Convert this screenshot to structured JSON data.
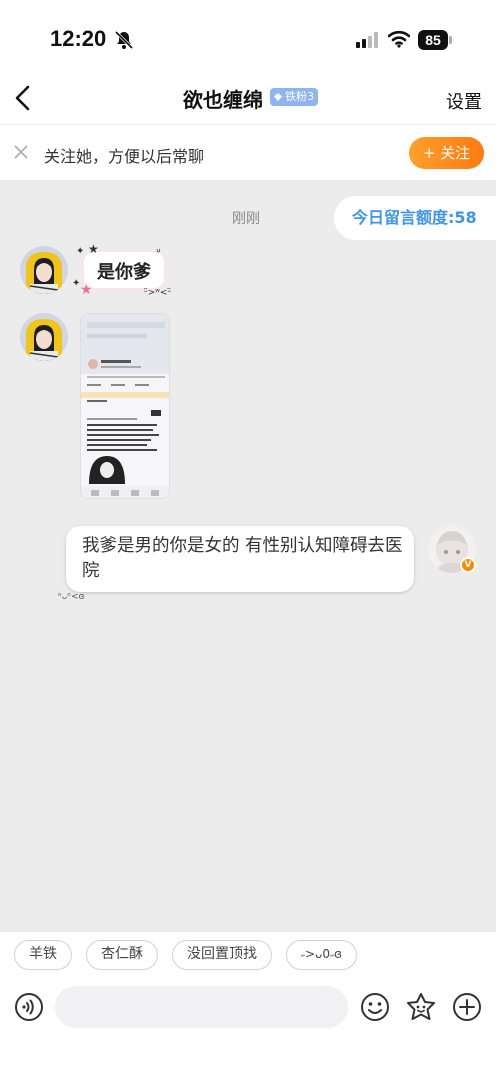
{
  "status_bar": {
    "time": "12:20",
    "battery": "85"
  },
  "nav": {
    "title": "欲也缠绵",
    "badge": "铁粉3",
    "settings": "设置"
  },
  "follow_bar": {
    "text": "关注她，方便以后常聊",
    "button": "+ 关注"
  },
  "quota": {
    "text": "今日留言额度:58"
  },
  "timestamp": "刚刚",
  "messages": {
    "sticker_text": "是你爹",
    "sticker_deco": "ᵕ̈>ʷ<ᵕ̈",
    "own_text": "我爹是男的你是女的 有性别认知障碍去医院",
    "own_deco": "ᵒᴗᵒ<ɞ",
    "v_badge": "V"
  },
  "quick_replies": [
    "羊铁",
    "杏仁酥",
    "没回置顶找",
    "˶>ᴗ0˶ɞ"
  ],
  "input": {
    "placeholder": ""
  },
  "colors": {
    "accent_orange": "#ff8a1e",
    "quota_blue": "#3e95e8",
    "badge_blue": "#8fb5f0"
  }
}
